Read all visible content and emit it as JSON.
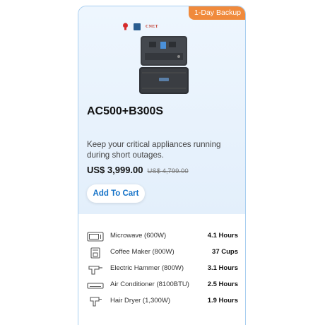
{
  "badge": "1-Day Backup",
  "awards": {
    "cnet_text": "CNET"
  },
  "product": {
    "name": "AC500+B300S",
    "description": "Keep your critical appliances running during short outages.",
    "price": "US$ 3,999.00",
    "old_price": "US$ 4,799.00",
    "cta": "Add To Cart"
  },
  "appliances": [
    {
      "icon": "microwave-icon",
      "name": "Microwave (600W)",
      "value": "4.1 Hours"
    },
    {
      "icon": "coffee-maker-icon",
      "name": "Coffee Maker (800W)",
      "value": "37 Cups"
    },
    {
      "icon": "electric-hammer-icon",
      "name": "Electric Hammer (800W)",
      "value": "3.1 Hours"
    },
    {
      "icon": "air-conditioner-icon",
      "name": "Air Conditioner (8100BTU)",
      "value": "2.5 Hours"
    },
    {
      "icon": "hair-dryer-icon",
      "name": "Hair Dryer (1,300W)",
      "value": "1.9 Hours"
    }
  ],
  "colors": {
    "accent": "#1673c8",
    "badge": "#f08a3c",
    "border": "#a8cef0"
  }
}
